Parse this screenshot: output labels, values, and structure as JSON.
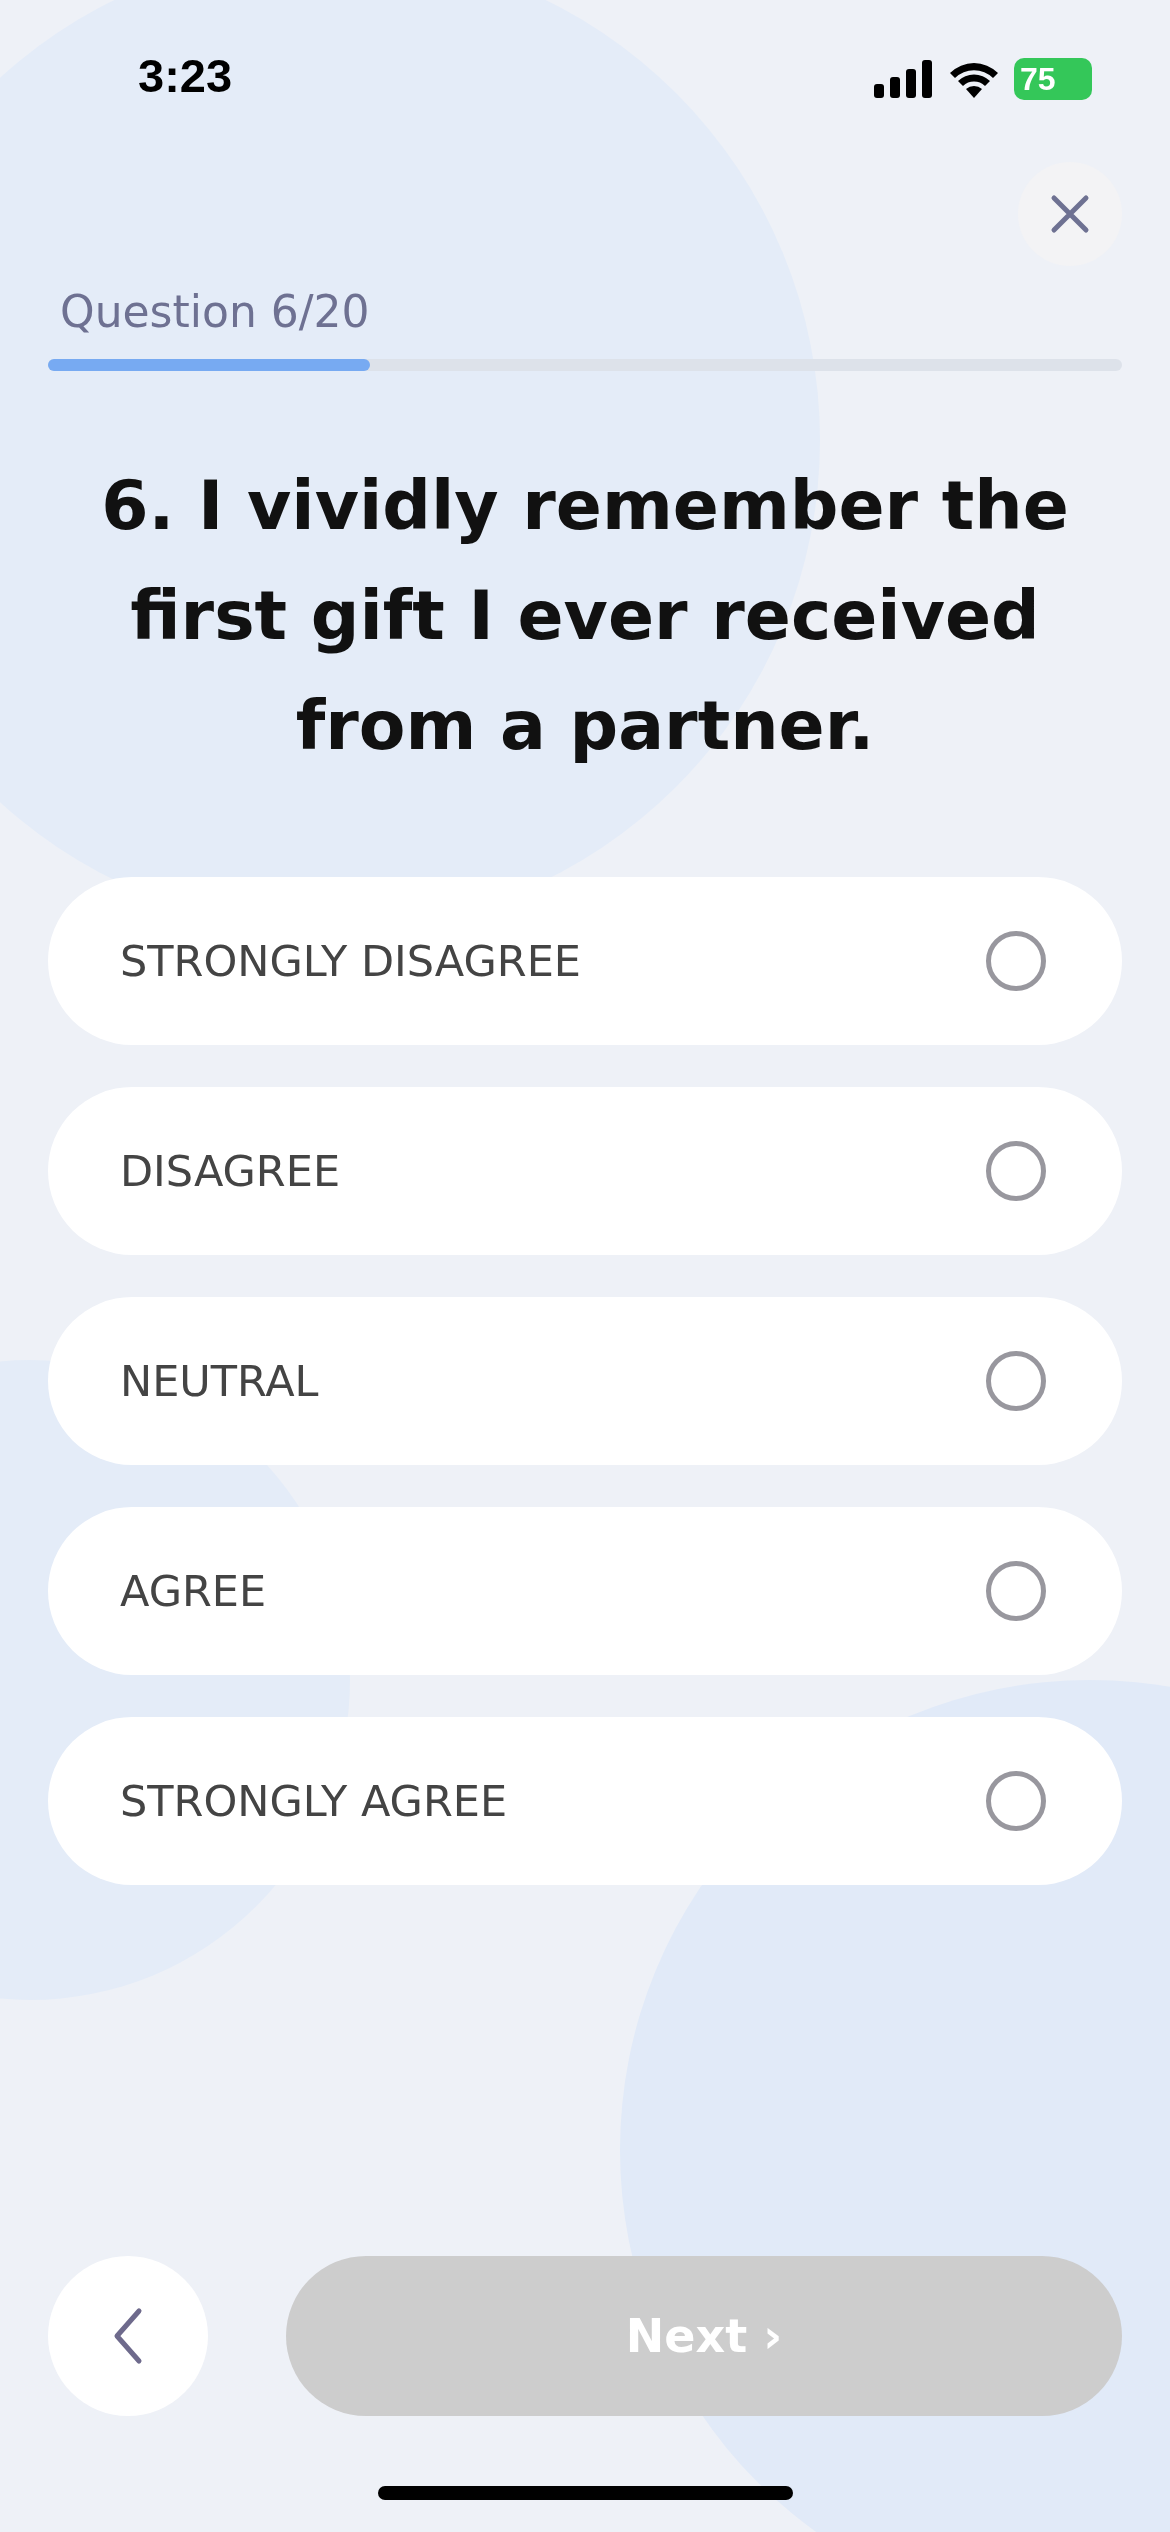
{
  "status_bar": {
    "time": "3:23",
    "battery": "75"
  },
  "progress": {
    "label": "Question 6/20",
    "level": 0.3
  },
  "question": "6. I vividly remember the first gift I ever received from a partner.",
  "options": [
    {
      "label": "STRONGLY DISAGREE",
      "selected": false
    },
    {
      "label": "DISAGREE",
      "selected": false
    },
    {
      "label": "NEUTRAL",
      "selected": false
    },
    {
      "label": "AGREE",
      "selected": false
    },
    {
      "label": "STRONGLY AGREE",
      "selected": false
    }
  ],
  "next_button": {
    "label": "Next ›",
    "disabled": true
  }
}
